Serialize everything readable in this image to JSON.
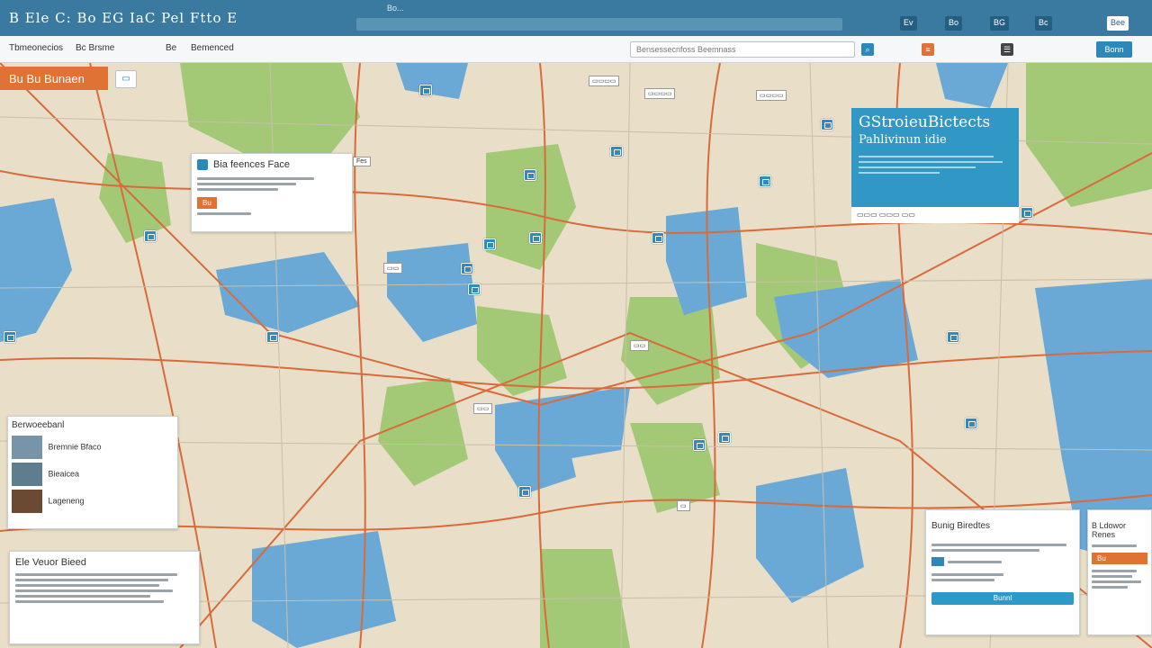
{
  "window": {
    "title": "B Ele C: Bo EG IaC Pel Ftto E",
    "tabs": [
      "Bo..."
    ],
    "controls": [
      "Ev",
      "Bo",
      "BG",
      "Bc",
      "Bee"
    ]
  },
  "toolbar": {
    "items": [
      "Tbmeonecios",
      "Bc Brsme",
      "Be",
      "Bemenced"
    ],
    "search_placeholder": "Bensessecnfoss Beemnass",
    "button": "Bonn"
  },
  "banner": {
    "label": "Bu Bu Bunaen"
  },
  "panels": {
    "info": {
      "title": "Bia feences Face",
      "badge": "Fes",
      "action": "Bu"
    },
    "promo": {
      "title": "GStroieuBictects",
      "subtitle": "Pahlivinun idie"
    },
    "results": {
      "title": "Berwoeebanl",
      "items": [
        "Bremnie Bfaco",
        "Bieaicea",
        "Lageneng"
      ]
    },
    "notes": {
      "title": "Ele Veuor Bieed"
    },
    "route": {
      "title": "Bunig Biredtes",
      "button": "Bunnl"
    },
    "side": {
      "title": "B Ldowor Renes",
      "action": "Bu"
    }
  },
  "colors": {
    "land": "#e9dfc8",
    "water": "#6aa9d6",
    "forest": "#a3c977",
    "road": "#d96a3b",
    "accent": "#2c88b8",
    "orange": "#e07333"
  },
  "icons": [
    "map-marker-icon",
    "search-icon",
    "menu-icon"
  ]
}
